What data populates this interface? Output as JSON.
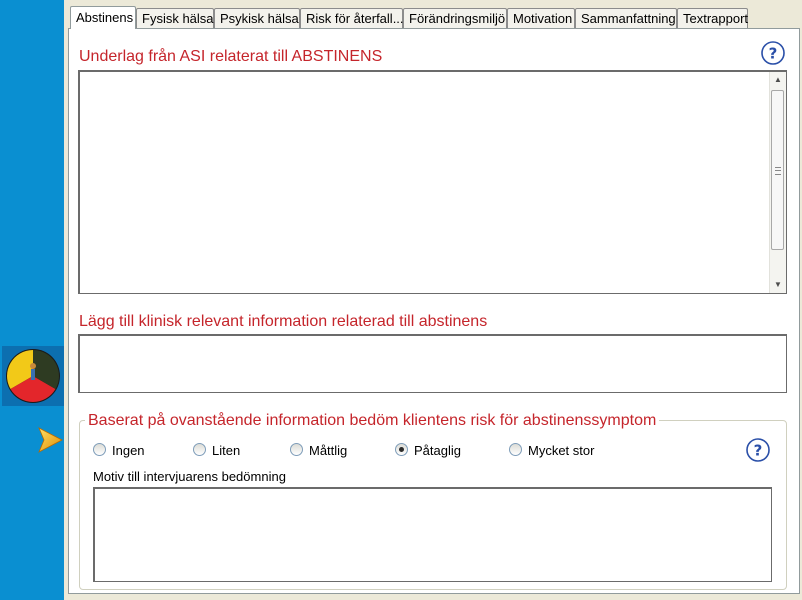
{
  "tabs": [
    {
      "label": "Abstinens",
      "active": true
    },
    {
      "label": "Fysisk hälsa"
    },
    {
      "label": "Psykisk hälsa"
    },
    {
      "label": "Risk för återfall..."
    },
    {
      "label": "Förändringsmiljö"
    },
    {
      "label": "Motivation"
    },
    {
      "label": "Sammanfattning"
    },
    {
      "label": "Textrapport"
    }
  ],
  "section1": {
    "heading": "Underlag från ASI relaterat till ABSTINENS"
  },
  "section2": {
    "heading": "Lägg till klinisk relevant information relaterad till abstinens"
  },
  "assessment": {
    "title": "Baserat på ovanstående information bedöm klientens risk för abstinenssymptom",
    "options": [
      "Ingen",
      "Liten",
      "Måttlig",
      "Påtaglig",
      "Mycket stor"
    ],
    "selected": "Påtaglig",
    "motiv_label": "Motiv till intervjuarens bedömning"
  },
  "icons": {
    "help": "help-question-icon",
    "pie": "pie-chart-person-icon",
    "next": "arrow-right-icon"
  },
  "colors": {
    "accent": "#c5252b",
    "sidebar": "#0a8fd1"
  }
}
